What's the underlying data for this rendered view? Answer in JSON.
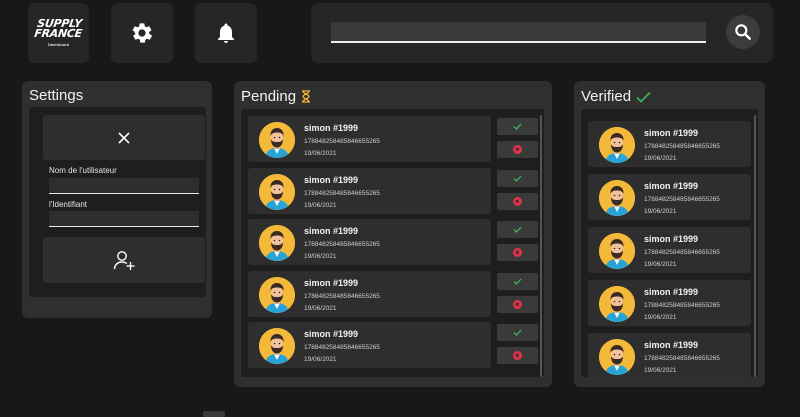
{
  "brand": {
    "logo_line1": "SUPPLY",
    "logo_line2": "FRANCE",
    "logo_sub": "Dashboard"
  },
  "search": {
    "value": "",
    "placeholder": ""
  },
  "settings": {
    "title": "Settings",
    "username_label": "Nom de l'utilisateur",
    "identifier_label": "l'Identifiant"
  },
  "pending": {
    "title": "Pending",
    "items": [
      {
        "name": "simon #1999",
        "id": "178848258485846655265",
        "date": "19/06/2021"
      },
      {
        "name": "simon #1999",
        "id": "178848258485846655265",
        "date": "19/06/2021"
      },
      {
        "name": "simon #1999",
        "id": "178848258485846655265",
        "date": "19/06/2021"
      },
      {
        "name": "simon #1999",
        "id": "178848258485846655265",
        "date": "19/06/2021"
      },
      {
        "name": "simon #1999",
        "id": "178848258485846655265",
        "date": "19/06/2021"
      }
    ]
  },
  "verified": {
    "title": "Verified",
    "items": [
      {
        "name": "simon #1999",
        "id": "178848258485846655265",
        "date": "19/06/2021"
      },
      {
        "name": "simon #1999",
        "id": "178848258485846655265",
        "date": "19/06/2021"
      },
      {
        "name": "simon #1999",
        "id": "178848258485846655265",
        "date": "19/06/2021"
      },
      {
        "name": "simon #1999",
        "id": "178848258485846655265",
        "date": "19/06/2021"
      },
      {
        "name": "simon #1999",
        "id": "178848258485846655265",
        "date": "19/06/2021"
      }
    ]
  },
  "icons": {
    "settings": "gear-icon",
    "notifications": "bell-icon",
    "search": "search-icon",
    "close": "close-icon",
    "add_user": "add-user-icon",
    "pending": "hourglass-icon",
    "verified": "check-icon",
    "approve": "check-icon",
    "reject": "reject-icon"
  },
  "colors": {
    "background": "#181818",
    "panel": "#2f2f2f",
    "accent_gold": "#f5b93a",
    "approve_green": "#3cb55a",
    "reject_red": "#e0344b"
  }
}
